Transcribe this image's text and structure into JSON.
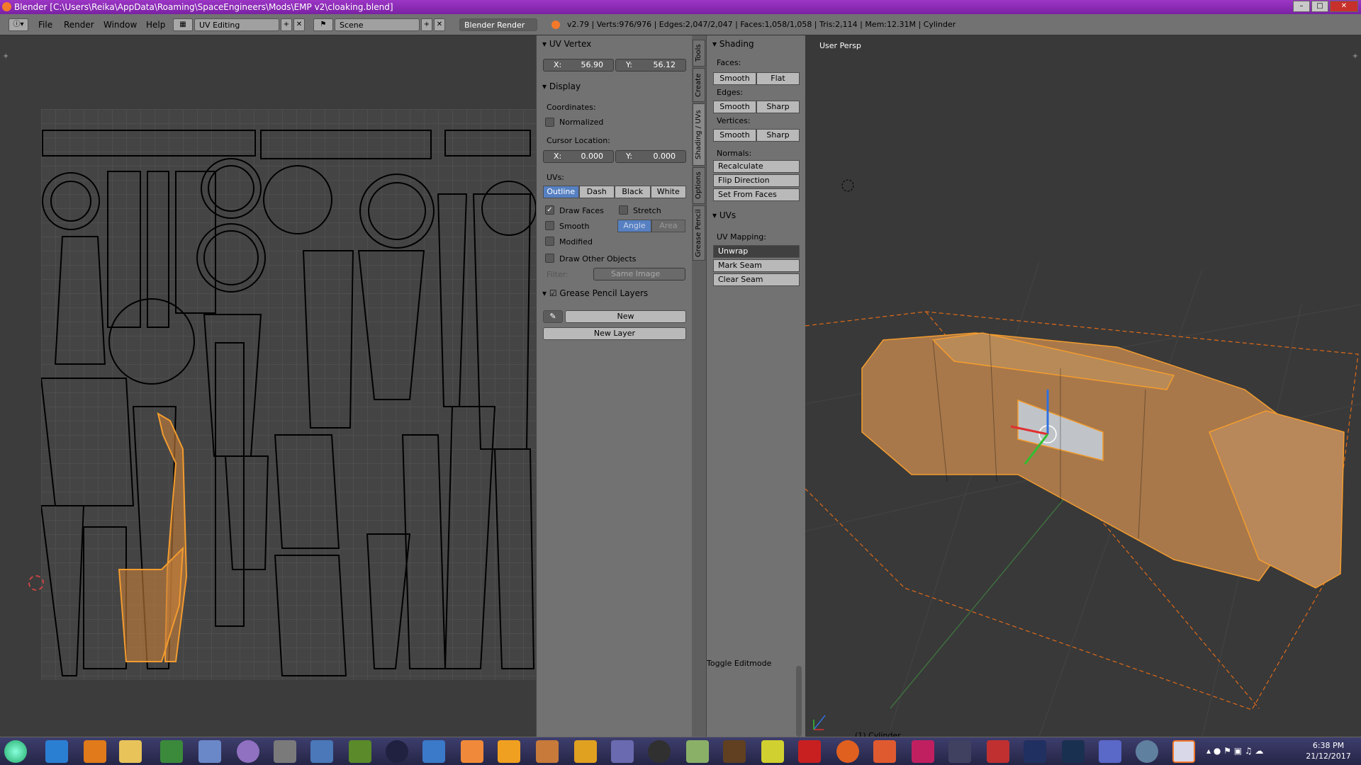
{
  "window": {
    "title": "Blender [C:\\Users\\Reika\\AppData\\Roaming\\SpaceEngineers\\Mods\\EMP v2\\cloaking.blend]"
  },
  "menu": {
    "items": [
      "File",
      "Render",
      "Window",
      "Help"
    ]
  },
  "header": {
    "layout": "UV Editing",
    "scene": "Scene",
    "engine": "Blender Render",
    "stats": "v2.79 | Verts:976/976 | Edges:2,047/2,047 | Faces:1,058/1,058 | Tris:2,114 | Mem:12.31M | Cylinder"
  },
  "uv_panel": {
    "uv_vertex": {
      "header": "UV Vertex",
      "x_label": "X:",
      "x": "56.90",
      "y_label": "Y:",
      "y": "56.12"
    },
    "display": {
      "header": "Display",
      "coordinates_label": "Coordinates:",
      "normalized": "Normalized",
      "cursor_label": "Cursor Location:",
      "cursor_x_label": "X:",
      "cursor_x": "0.000",
      "cursor_y_label": "Y:",
      "cursor_y": "0.000",
      "uvs_label": "UVs:",
      "uv_styles": [
        "Outline",
        "Dash",
        "Black",
        "White"
      ],
      "draw_faces": "Draw Faces",
      "stretch": "Stretch",
      "smooth": "Smooth",
      "angle": "Angle",
      "area": "Area",
      "modified": "Modified",
      "draw_other": "Draw Other Objects",
      "filter_label": "Filter:",
      "filter_value": "Same Image"
    },
    "grease": {
      "header": "Grease Pencil Layers",
      "new": "New",
      "new_layer": "New Layer"
    }
  },
  "tabs": [
    "Tools",
    "Create",
    "Shading / UVs",
    "Options",
    "Grease Pencil"
  ],
  "tools": {
    "shading_header": "Shading",
    "faces_label": "Faces:",
    "faces": [
      "Smooth",
      "Flat"
    ],
    "edges_label": "Edges:",
    "edges": [
      "Smooth",
      "Sharp"
    ],
    "vertices_label": "Vertices:",
    "vertices": [
      "Smooth",
      "Sharp"
    ],
    "normals_label": "Normals:",
    "normals": [
      "Recalculate",
      "Flip Direction",
      "Set From Faces"
    ],
    "uvs_header": "UVs",
    "uv_mapping_label": "UV Mapping:",
    "unwrap": "Unwrap",
    "mark_seam": "Mark Seam",
    "clear_seam": "Clear Seam",
    "toggle": "Toggle Editmode"
  },
  "viewport": {
    "label": "User Persp",
    "object": "(1) Cylinder"
  },
  "taskbar": {
    "time": "6:38 PM",
    "date": "21/12/2017"
  },
  "colors": {
    "title": "#9c36c6",
    "selection": "#f39c2f",
    "active_button": "#5680c2"
  }
}
